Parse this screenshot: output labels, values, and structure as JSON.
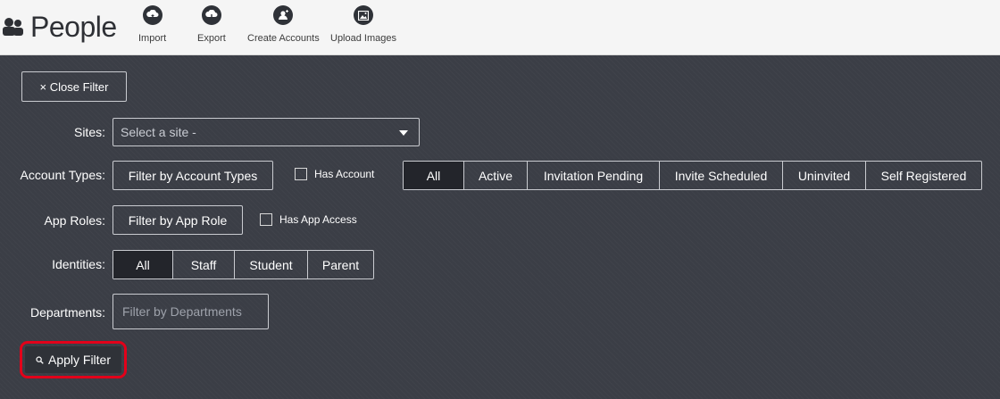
{
  "header": {
    "title": "People",
    "tools": [
      {
        "label": "Import",
        "icon": "cloud-upload-icon"
      },
      {
        "label": "Export",
        "icon": "cloud-download-icon"
      },
      {
        "label": "Create Accounts",
        "icon": "add-user-icon"
      },
      {
        "label": "Upload Images",
        "icon": "image-icon"
      }
    ]
  },
  "filter": {
    "close_label": "× Close Filter",
    "sites": {
      "label": "Sites:",
      "placeholder": "Select a site -"
    },
    "account_types": {
      "label": "Account Types:",
      "button": "Filter by Account Types",
      "checkbox": "Has Account",
      "segments": [
        "All",
        "Active",
        "Invitation Pending",
        "Invite Scheduled",
        "Uninvited",
        "Self Registered"
      ],
      "selected": "All"
    },
    "app_roles": {
      "label": "App Roles:",
      "button": "Filter by App Role",
      "checkbox": "Has App Access"
    },
    "identities": {
      "label": "Identities:",
      "segments": [
        "All",
        "Staff",
        "Student",
        "Parent"
      ],
      "selected": "All"
    },
    "departments": {
      "label": "Departments:",
      "placeholder": "Filter by Departments"
    },
    "apply_label": "Apply Filter"
  },
  "colors": {
    "panel": "#3b3e46",
    "active_segment": "#23252b",
    "highlight": "#e2001a"
  }
}
